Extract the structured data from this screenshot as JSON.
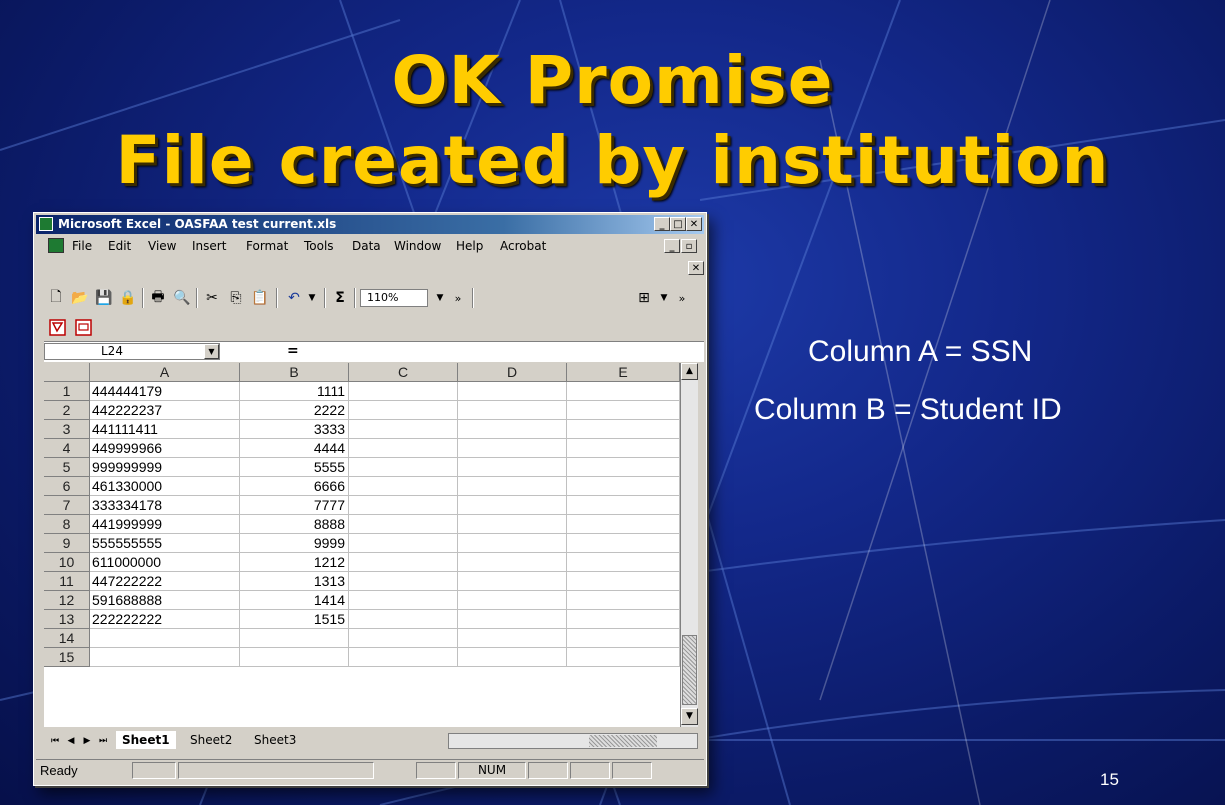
{
  "slide": {
    "title_line1": "OK Promise",
    "title_line2": "File created by institution",
    "note_col_a": "Column A = SSN",
    "note_col_b": "Column B = Student ID",
    "page_number": "15",
    "colors": {
      "background": "#13288a",
      "title": "#ffcc00",
      "text": "#ffffff"
    }
  },
  "excel": {
    "window_title": "Microsoft Excel - OASFAA test current.xls",
    "menu": [
      "File",
      "Edit",
      "View",
      "Insert",
      "Format",
      "Tools",
      "Data",
      "Window",
      "Help",
      "Acrobat"
    ],
    "zoom": "110%",
    "name_box": "L24",
    "formula_equals": "=",
    "columns": [
      "A",
      "B",
      "C",
      "D",
      "E"
    ],
    "rows": [
      {
        "n": "1",
        "a": "444444179",
        "b": "1111"
      },
      {
        "n": "2",
        "a": "442222237",
        "b": "2222"
      },
      {
        "n": "3",
        "a": "441111411",
        "b": "3333"
      },
      {
        "n": "4",
        "a": "449999966",
        "b": "4444"
      },
      {
        "n": "5",
        "a": "999999999",
        "b": "5555"
      },
      {
        "n": "6",
        "a": "461330000",
        "b": "6666"
      },
      {
        "n": "7",
        "a": "333334178",
        "b": "7777"
      },
      {
        "n": "8",
        "a": "441999999",
        "b": "8888"
      },
      {
        "n": "9",
        "a": "555555555",
        "b": "9999"
      },
      {
        "n": "10",
        "a": "611000000",
        "b": "1212"
      },
      {
        "n": "11",
        "a": "447222222",
        "b": "1313"
      },
      {
        "n": "12",
        "a": "591688888",
        "b": "1414"
      },
      {
        "n": "13",
        "a": "222222222",
        "b": "1515"
      },
      {
        "n": "14",
        "a": "",
        "b": ""
      },
      {
        "n": "15",
        "a": "",
        "b": ""
      }
    ],
    "sheets": [
      "Sheet1",
      "Sheet2",
      "Sheet3"
    ],
    "active_sheet": "Sheet1",
    "status_text": "Ready",
    "status_indicator": "NUM"
  }
}
